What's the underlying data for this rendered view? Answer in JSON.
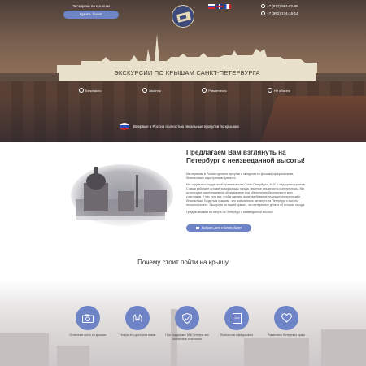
{
  "header": {
    "excursion_label": "Экскурсии по крышам",
    "buy_ticket": "Купить билет",
    "languages": [
      "ru",
      "en",
      "fr"
    ],
    "phones": [
      "+7 (812) 984-02-86",
      "+7 (952) 174-16-14"
    ],
    "logo": "ticket-logo"
  },
  "hero": {
    "title": "Экскурсии по крышам Санкт-Петербурга",
    "features": [
      {
        "icon": "shield-check-icon",
        "label": "Безопасно"
      },
      {
        "icon": "law-icon",
        "label": "Законно"
      },
      {
        "icon": "smile-icon",
        "label": "Романтично"
      },
      {
        "icon": "star-icon",
        "label": "Не обычно"
      }
    ],
    "legal_note": "Впервые в России полностью легальные прогулки по крышам"
  },
  "intro": {
    "title": "Предлагаем Вам взглянуть на Петербург с неизведанной высоты!",
    "paragraphs": [
      "Мы первыми в России сделали прогулки и экскурсии по крышам официальными, безопасными и доступными для всех.",
      "Мы заручились поддержкой правительства Санкт-Петербурга, МЧС и надзорных органов. С нами работают лучшие экскурсоводы города, опытные альпинисты и инструкторы. Мы используем самое надежное оборудование для обеспечения безопасности всех участников. У нас есть все, чтобы сделать ваше пребывание на крыше интересным и безопасным. Гордиться крышам - это возможность взглянуть на Петербург с высоты птичьего полета. Экскурсия на нашей крыше - это интересные детали об истории города.",
      "Предлагаем вам взглянуть на Петербург с неизведанной высоты!"
    ],
    "cta": "Выбрать дату и Купить билет"
  },
  "why": {
    "title": "Почему стоит пойти на крышу",
    "reasons": [
      {
        "icon": "camera-icon",
        "label": "Отличные фото на крышах"
      },
      {
        "icon": "hands-icon",
        "label": "Теперь это доступно и вам"
      },
      {
        "icon": "shield-icon",
        "label": "При поддержке МЧС теперь это полностью безопасно"
      },
      {
        "icon": "document-icon",
        "label": "Полностью официально"
      },
      {
        "icon": "heart-icon",
        "label": "Романтика Питерских крыш"
      }
    ]
  },
  "colors": {
    "accent": "#6f84c6",
    "band": "#e9e1cc",
    "hero_dark": "#4a3b33"
  }
}
